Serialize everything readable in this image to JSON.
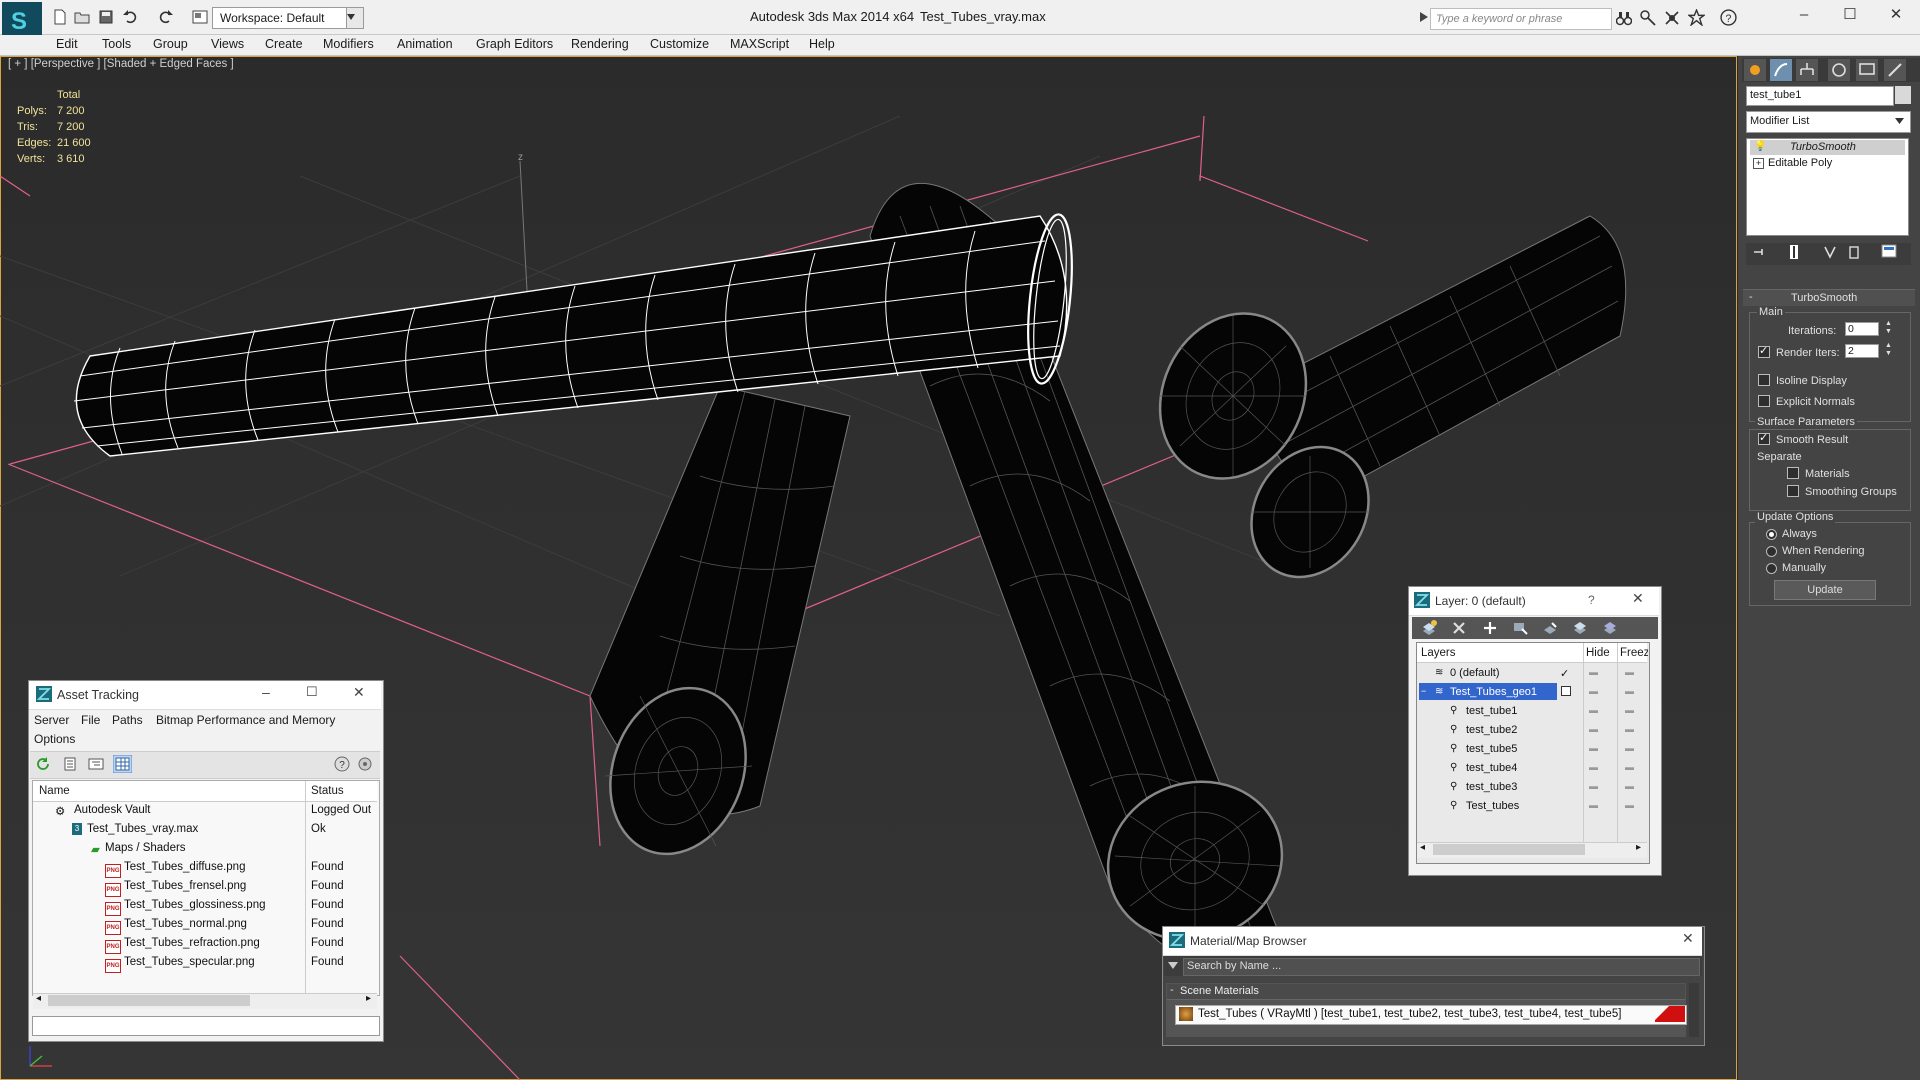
{
  "titlebar": {
    "app_title": "Autodesk 3ds Max  2014 x64",
    "doc_title": "Test_Tubes_vray.max",
    "workspace": "Workspace: Default",
    "search_placeholder": "Type a keyword or phrase"
  },
  "menu": [
    "Edit",
    "Tools",
    "Group",
    "Views",
    "Create",
    "Modifiers",
    "Animation",
    "Graph Editors",
    "Rendering",
    "Customize",
    "MAXScript",
    "Help"
  ],
  "viewport": {
    "label": "[ + ] [Perspective ] [Shaded + Edged Faces ]",
    "stats": {
      "header": "Total",
      "rows": [
        {
          "label": "Polys:",
          "value": "7 200"
        },
        {
          "label": "Tris:",
          "value": "7 200"
        },
        {
          "label": "Edges:",
          "value": "21 600"
        },
        {
          "label": "Verts:",
          "value": "3 610"
        }
      ]
    },
    "axis_label": "z"
  },
  "command_panel": {
    "object_name": "test_tube1",
    "modifier_list": "Modifier List",
    "stack": [
      "TurboSmooth",
      "Editable Poly"
    ],
    "rollout_title": "TurboSmooth",
    "main_label": "Main",
    "iterations_label": "Iterations:",
    "iterations_value": "0",
    "render_iters_label": "Render Iters:",
    "render_iters_value": "2",
    "isoline": "Isoline Display",
    "explicit_normals": "Explicit Normals",
    "surface_params": "Surface Parameters",
    "smooth_result": "Smooth Result",
    "separate": "Separate",
    "materials": "Materials",
    "smoothing_groups": "Smoothing Groups",
    "update_options": "Update Options",
    "always": "Always",
    "when_rendering": "When Rendering",
    "manually": "Manually",
    "update_button": "Update"
  },
  "asset_tracking": {
    "title": "Asset Tracking",
    "menu": [
      "Server",
      "File",
      "Paths",
      "Bitmap Performance and Memory"
    ],
    "menu2": "Options",
    "col_name": "Name",
    "col_status": "Status",
    "rows": [
      {
        "name": "Autodesk Vault",
        "status": "Logged Out"
      },
      {
        "name": "Test_Tubes_vray.max",
        "status": "Ok"
      },
      {
        "name": "Maps / Shaders",
        "status": ""
      },
      {
        "name": "Test_Tubes_diffuse.png",
        "status": "Found"
      },
      {
        "name": "Test_Tubes_frensel.png",
        "status": "Found"
      },
      {
        "name": "Test_Tubes_glossiness.png",
        "status": "Found"
      },
      {
        "name": "Test_Tubes_normal.png",
        "status": "Found"
      },
      {
        "name": "Test_Tubes_refraction.png",
        "status": "Found"
      },
      {
        "name": "Test_Tubes_specular.png",
        "status": "Found"
      }
    ],
    "png_badge": "PNG"
  },
  "layer_window": {
    "title": "Layer: 0 (default)",
    "help": "?",
    "col_layers": "Layers",
    "col_hide": "Hide",
    "col_freeze": "Freeze",
    "rows": [
      "0 (default)",
      "Test_Tubes_geo1",
      "test_tube1",
      "test_tube2",
      "test_tube5",
      "test_tube4",
      "test_tube3",
      "Test_tubes"
    ]
  },
  "material_browser": {
    "title": "Material/Map Browser",
    "search_placeholder": "Search by Name ...",
    "section": "Scene Materials",
    "material": "Test_Tubes  ( VRayMtl ) [test_tube1, test_tube2, test_tube3, test_tube4, test_tube5]"
  },
  "colors": {
    "viewport_bg": "#2c2c2c",
    "grid_pink": "#e0608a",
    "selection_blue": "#3366cc",
    "wire_white": "#ffffff",
    "wire_gray": "#8a8a8a"
  }
}
